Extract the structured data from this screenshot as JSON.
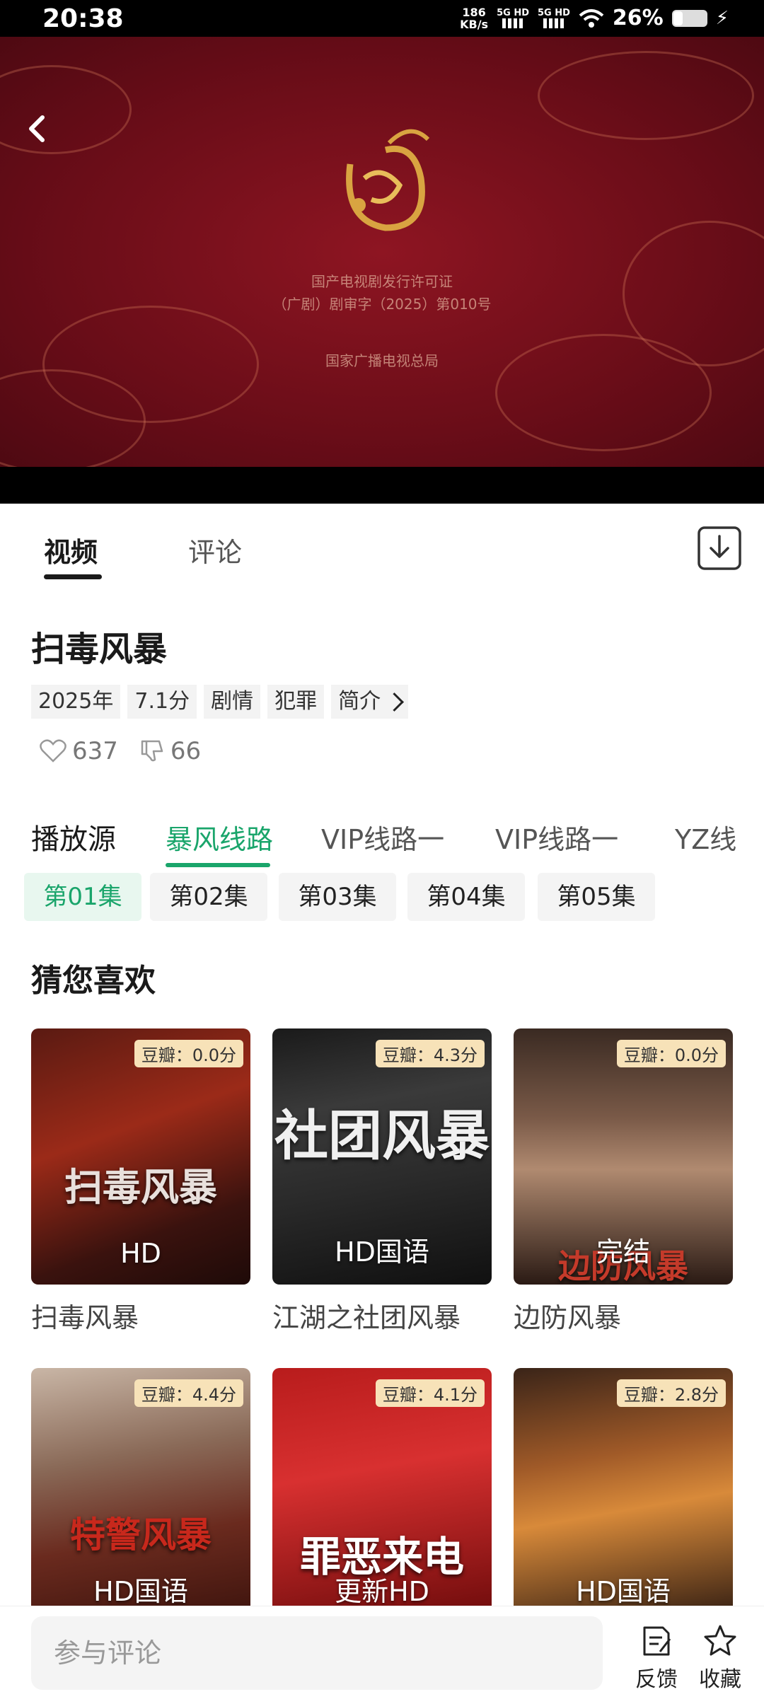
{
  "status_bar": {
    "time": "20:38",
    "net_speed_value": "186",
    "net_speed_unit": "KB/s",
    "sim1": "5G HD",
    "sim2": "5G HD",
    "battery": "26%"
  },
  "video": {
    "cert_line1": "国产电视剧发行许可证",
    "cert_line2": "（广剧）剧审字（2025）第010号",
    "cert_line3": "国家广播电视总局"
  },
  "tabs": [
    {
      "label": "视频",
      "active": true
    },
    {
      "label": "评论",
      "active": false
    }
  ],
  "detail": {
    "title": "扫毒风暴",
    "tags": [
      "2025年",
      "7.1分",
      "剧情",
      "犯罪",
      "简介"
    ],
    "likes": "637",
    "dislikes": "66"
  },
  "sources": {
    "label": "播放源",
    "items": [
      "暴风线路",
      "VIP线路一",
      "VIP线路一",
      "YZ线"
    ],
    "active_index": 0
  },
  "episodes": [
    "第01集",
    "第02集",
    "第03集",
    "第04集",
    "第05集"
  ],
  "recommend": {
    "title": "猜您喜欢",
    "items": [
      {
        "name": "扫毒风暴",
        "badge": "豆瓣：0.0分",
        "status": "HD",
        "poster_title": "扫毒风暴"
      },
      {
        "name": "江湖之社团风暴",
        "badge": "豆瓣：4.3分",
        "status": "HD国语",
        "poster_title": "社团风暴"
      },
      {
        "name": "边防风暴",
        "badge": "豆瓣：0.0分",
        "status": "完结",
        "poster_title": "边防风暴"
      },
      {
        "name": "",
        "badge": "豆瓣：4.4分",
        "status": "HD国语",
        "poster_title": "特警风暴"
      },
      {
        "name": "",
        "badge": "豆瓣：4.1分",
        "status": "更新HD",
        "poster_title": "罪恶来电"
      },
      {
        "name": "",
        "badge": "豆瓣：2.8分",
        "status": "HD国语",
        "poster_title": ""
      }
    ]
  },
  "bottom_bar": {
    "comment_placeholder": "参与评论",
    "feedback_label": "反馈",
    "favorite_label": "收藏"
  },
  "colors": {
    "accent": "#1aa56b",
    "badge_bg": "#f7e2b8",
    "video_bg": "#7a1020"
  }
}
